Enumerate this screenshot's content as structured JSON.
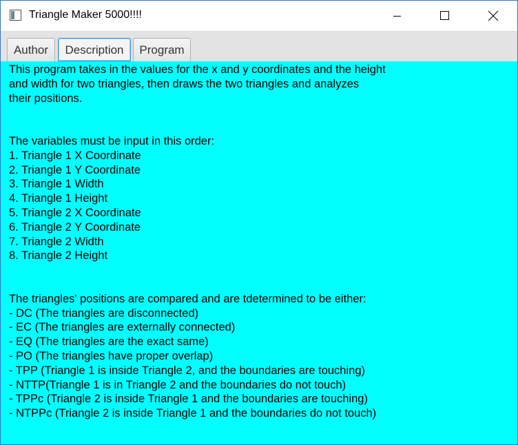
{
  "window": {
    "title": "Triangle Maker 5000!!!!"
  },
  "icons": {
    "app": "app-window-icon",
    "minimize": "minimize-icon",
    "maximize": "maximize-icon",
    "close": "close-icon"
  },
  "tabs": [
    {
      "label": "Author"
    },
    {
      "label": "Description"
    },
    {
      "label": "Program"
    }
  ],
  "selected_tab": "Description",
  "colors": {
    "content_background": "#00ffff",
    "selected_tab_border": "#3c8fd6"
  },
  "description": {
    "intro": [
      "This program takes in the values for the x and y coordinates and the height",
      "and width for two triangles, then draws the two triangles and analyzes",
      "their positions."
    ],
    "order_heading": "The variables must be input in this order:",
    "order_items": [
      "1. Triangle 1 X Coordinate",
      "2. Triangle 1 Y Coordinate",
      "3. Triangle 1 Width",
      "4. Triangle 1 Height",
      "5. Triangle 2 X Coordinate",
      "6. Triangle 2 Y Coordinate",
      "7. Triangle 2 Width",
      "8. Triangle 2 Height"
    ],
    "positions_heading": "The triangles' positions are compared and are tdetermined to be either:",
    "positions_items": [
      "- DC (The triangles are disconnected)",
      "- EC (The triangles are externally connected)",
      "- EQ (The triangles are the exact same)",
      "- PO (The triangles have proper overlap)",
      "- TPP (Triangle 1 is inside Triangle 2, and the boundaries are touching)",
      "- NTTP(Triangle 1 is in Triangle 2 and the boundaries do not touch)",
      "- TPPc (Triangle 2 is inside Triangle 1 and the boundaries are touching)",
      "- NTPPc (Triangle 2 is inside Triangle 1 and the boundaries do not touch)"
    ]
  }
}
